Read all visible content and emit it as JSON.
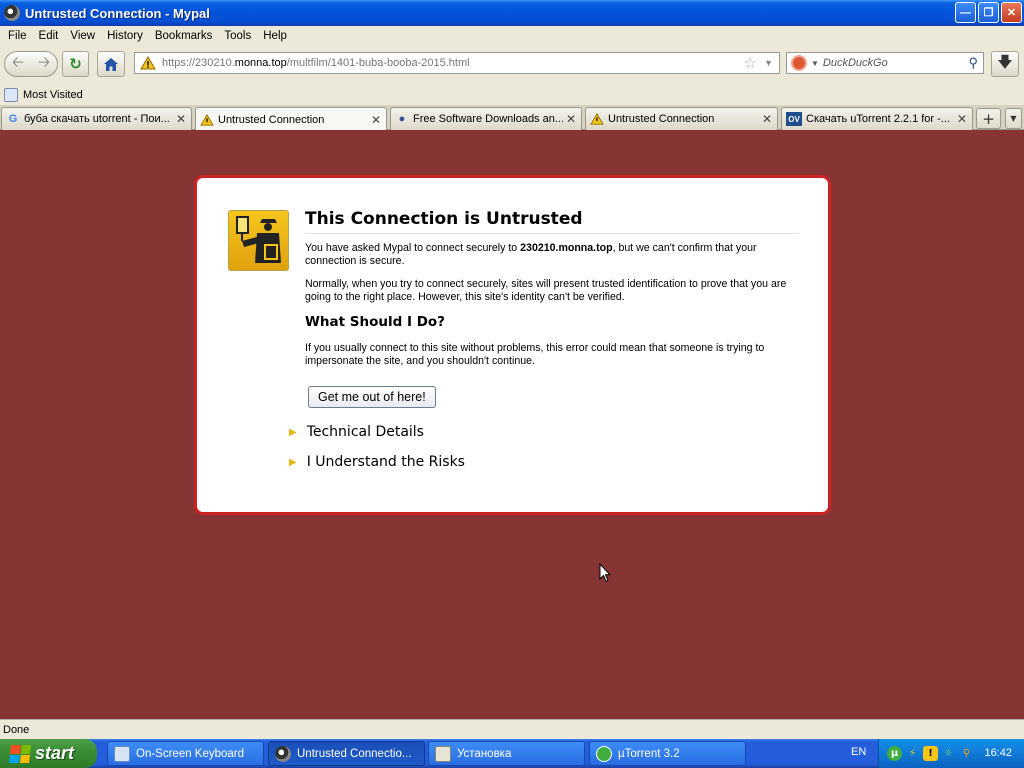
{
  "window": {
    "title": "Untrusted Connection - Mypal",
    "minimize_icon": "minimize-icon",
    "maximize_icon": "maximize-icon",
    "close_icon": "close-icon"
  },
  "menu": [
    "File",
    "Edit",
    "View",
    "History",
    "Bookmarks",
    "Tools",
    "Help"
  ],
  "nav": {
    "url_scheme_and_host_prefix": "https://230210.",
    "url_host_main": "monna.top",
    "url_path": "/multfilm/1401-buba-booba-2015.html",
    "search_placeholder": "DuckDuckGo"
  },
  "bookmarks": {
    "most_visited": "Most Visited"
  },
  "tabs": [
    {
      "label": "буба скачать utorrent - Пои...",
      "icon": "google-icon",
      "active": false
    },
    {
      "label": "Untrusted Connection",
      "icon": "warning-icon",
      "active": true
    },
    {
      "label": "Free Software Downloads an...",
      "icon": "paw-icon",
      "active": false
    },
    {
      "label": "Untrusted Connection",
      "icon": "warning-icon",
      "active": false
    },
    {
      "label": "Скачать uTorrent 2.2.1 for -...",
      "icon": "ov-icon",
      "active": false
    }
  ],
  "error": {
    "title": "This Connection is Untrusted",
    "p1_before": "You have asked Mypal to connect securely to ",
    "p1_host": "230210.monna.top",
    "p1_after": ", but we can't confirm that your connection is secure.",
    "p2": "Normally, when you try to connect securely, sites will present trusted identification to prove that you are going to the right place. However, this site's identity can't be verified.",
    "h2": "What Should I Do?",
    "p3": "If you usually connect to this site without problems, this error could mean that someone is trying to impersonate the site, and you shouldn't continue.",
    "button": "Get me out of here!",
    "technical_details": "Technical Details",
    "understand_risks": "I Understand the Risks"
  },
  "status": "Done",
  "taskbar": {
    "start": "start",
    "tasks": [
      {
        "label": "On-Screen Keyboard",
        "active": false
      },
      {
        "label": "Untrusted Connectio...",
        "active": true
      },
      {
        "label": "Установка",
        "active": false
      },
      {
        "label": "µTorrent 3.2",
        "active": false
      }
    ],
    "language": "EN",
    "clock": "16:42"
  },
  "colors": {
    "page_background": "#873435",
    "error_border": "#cc2222",
    "xp_blue": "#245edb",
    "start_green": "#3b8f35"
  }
}
